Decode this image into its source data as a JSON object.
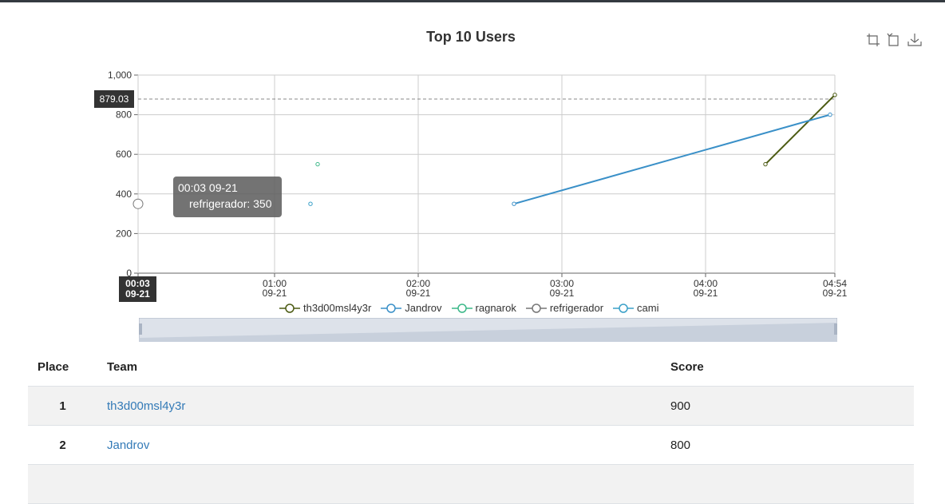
{
  "chart": {
    "title": "Top 10 Users",
    "toolbox": [
      "zoom-icon",
      "zoom-reset-icon",
      "save-image-icon"
    ],
    "axis_pointer_y_value": "879.03",
    "axis_pointer_x_value": {
      "time": "00:03",
      "date": "09-21"
    },
    "tooltip": {
      "time": "00:03 09-21",
      "row": "refrigerador: 350"
    },
    "legend": [
      "th3d00msl4y3r",
      "Jandrov",
      "ragnarok",
      "refrigerador",
      "cami"
    ]
  },
  "chart_data": {
    "type": "line",
    "title": "Top 10 Users",
    "ylim": [
      0,
      1000
    ],
    "yticks": [
      "0",
      "200",
      "400",
      "600",
      "800",
      "1,000"
    ],
    "xlim": [
      "00:03 09-21",
      "04:54 09-21"
    ],
    "xticks": [
      {
        "time": "00:03",
        "date": "09-21"
      },
      {
        "time": "01:00",
        "date": "09-21"
      },
      {
        "time": "02:00",
        "date": "09-21"
      },
      {
        "time": "03:00",
        "date": "09-21"
      },
      {
        "time": "04:00",
        "date": "09-21"
      },
      {
        "time": "04:54",
        "date": "09-21"
      }
    ],
    "grid": true,
    "legend_position": "bottom",
    "series": [
      {
        "name": "th3d00msl4y3r",
        "color": "#4b5a12",
        "points": [
          [
            "04:25",
            550
          ],
          [
            "04:54",
            900
          ]
        ]
      },
      {
        "name": "Jandrov",
        "color": "#3a90c8",
        "points": [
          [
            "02:40",
            350
          ],
          [
            "04:52",
            800
          ]
        ]
      },
      {
        "name": "ragnarok",
        "color": "#3cb889",
        "points": [
          [
            "01:18",
            550
          ]
        ]
      },
      {
        "name": "refrigerador",
        "color": "#777777",
        "points": [
          [
            "00:03",
            350
          ]
        ]
      },
      {
        "name": "cami",
        "color": "#3aa0c8",
        "points": [
          [
            "01:15",
            350
          ]
        ]
      }
    ]
  },
  "table": {
    "headers": {
      "place": "Place",
      "team": "Team",
      "score": "Score"
    },
    "rows": [
      {
        "place": "1",
        "team": "th3d00msl4y3r",
        "score": "900"
      },
      {
        "place": "2",
        "team": "Jandrov",
        "score": "800"
      }
    ]
  }
}
